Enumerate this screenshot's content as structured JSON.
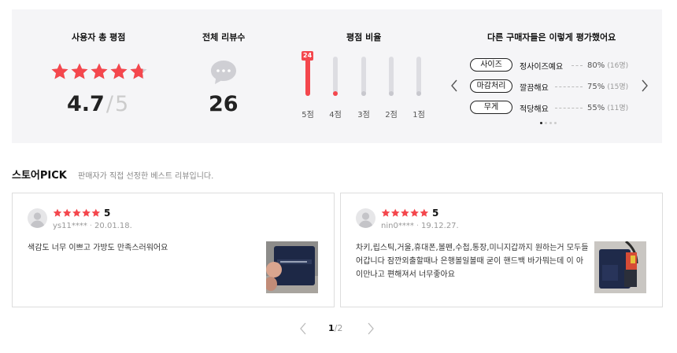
{
  "summary": {
    "rating_title": "사용자 총 평점",
    "average": "4.7",
    "slash": "/",
    "max": "5",
    "rating_fraction": 0.94,
    "reviews_title": "전체 리뷰수",
    "review_count": "26",
    "dist_title": "평점 비율",
    "top_badge": "24",
    "distribution": [
      {
        "label": "5점",
        "value": 24
      },
      {
        "label": "4점",
        "value": 2
      },
      {
        "label": "3점",
        "value": 0
      },
      {
        "label": "2점",
        "value": 0
      },
      {
        "label": "1점",
        "value": 0
      }
    ],
    "buyers_title": "다른 구매자들은 이렇게 평가했어요",
    "attributes": [
      {
        "name": "사이즈",
        "value": "정사이즈예요",
        "percent": "80%",
        "count": "(16명)"
      },
      {
        "name": "마감처리",
        "value": "깔끔해요",
        "percent": "75%",
        "count": "(15명)"
      },
      {
        "name": "무게",
        "value": "적당해요",
        "percent": "55%",
        "count": "(11명)"
      }
    ],
    "page_dots": 4,
    "active_dot": 0
  },
  "pick": {
    "title": "스토어PICK",
    "description": "판매자가 직접 선정한 베스트 리뷰입니다."
  },
  "reviews": [
    {
      "score": "5",
      "user": "ys11****",
      "date": "20.01.18.",
      "text": "색감도 너무 이쁘고 가방도 만족스러워어요"
    },
    {
      "score": "5",
      "user": "nin0****",
      "date": "19.12.27.",
      "text": "차키,립스틱,거울,휴대폰,볼펜,수첩,통장,미니지갑까지 원하는거 모두들어갑니다 잠깐외출할때나 은행볼일볼때 굳이 핸드백 바가뭐는데 이 아이만나고 편해져서 너무좋아요"
    }
  ],
  "pagination": {
    "current": "1",
    "separator": "/",
    "total": "2"
  },
  "colors": {
    "accent": "#f4474d",
    "panel": "#f5f5f7"
  }
}
